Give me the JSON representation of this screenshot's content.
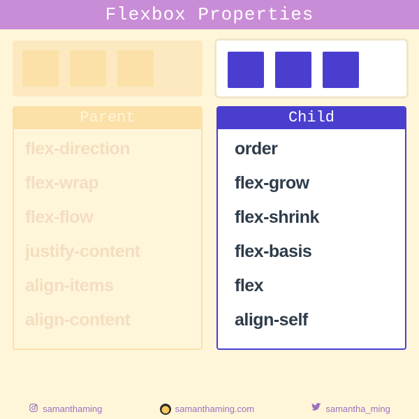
{
  "title": "Flexbox Properties",
  "parent": {
    "heading": "Parent",
    "properties": [
      "flex-direction",
      "flex-wrap",
      "flex-flow",
      "justify-content",
      "align-items",
      "align-content"
    ]
  },
  "child": {
    "heading": "Child",
    "properties": [
      "order",
      "flex-grow",
      "flex-shrink",
      "flex-basis",
      "flex",
      "align-self"
    ]
  },
  "footer": {
    "instagram": "samanthaming",
    "website": "samanthaming.com",
    "twitter": "samantha_ming"
  }
}
